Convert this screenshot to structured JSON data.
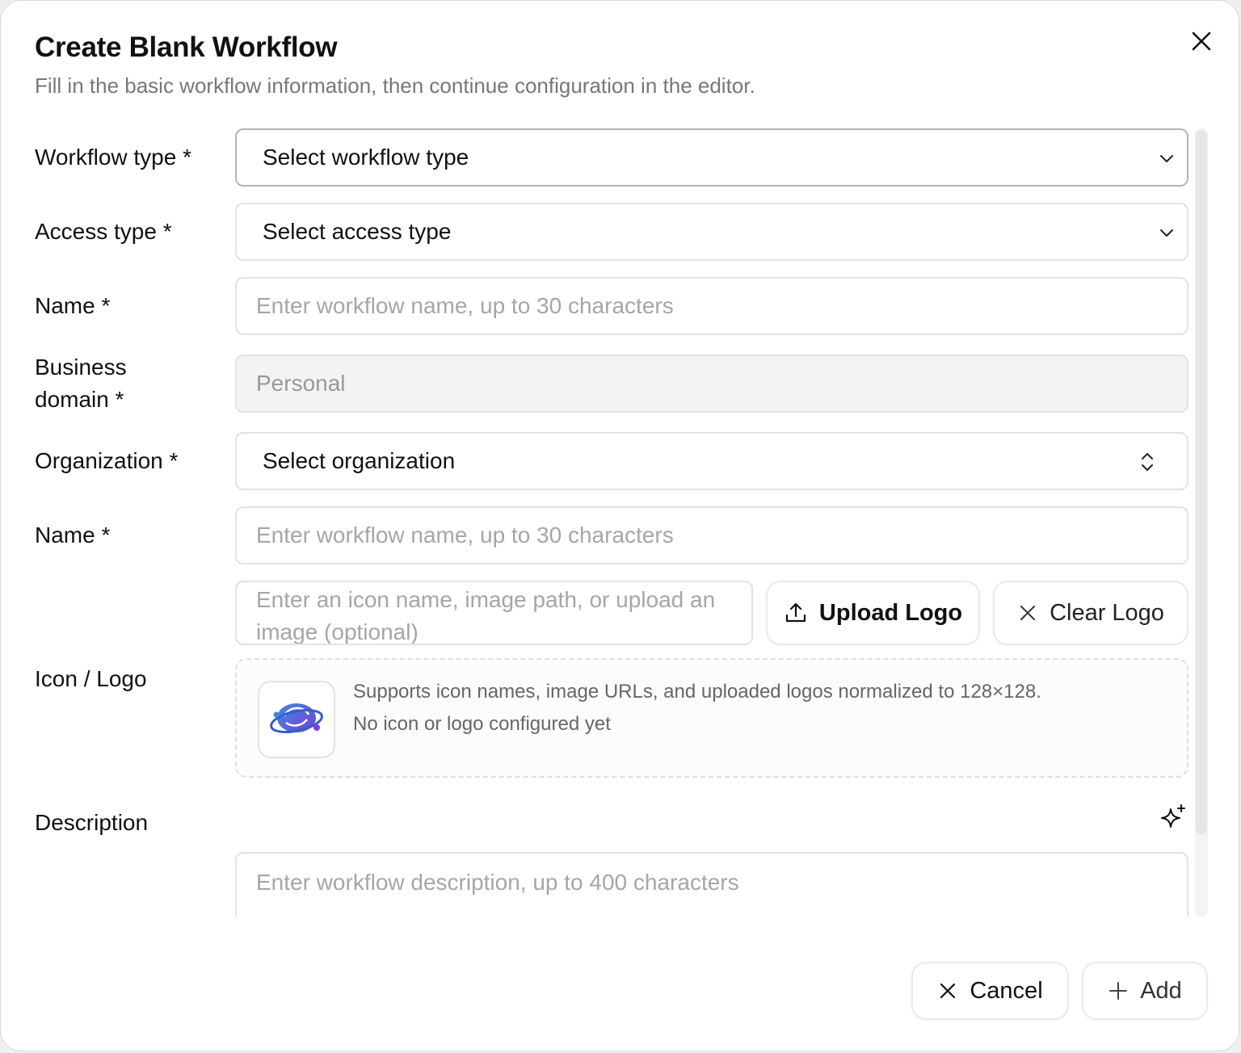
{
  "dialog": {
    "title": "Create Blank Workflow",
    "subtitle": "Fill in the basic workflow information, then continue configuration in the editor."
  },
  "form": {
    "workflow_type": {
      "label": "Workflow type *",
      "value": "Select workflow type"
    },
    "access_type": {
      "label": "Access type *",
      "value": "Select access type"
    },
    "name_1": {
      "label": "Name *",
      "placeholder": "Enter workflow name, up to 30 characters"
    },
    "business_domain": {
      "label_line1": "Business",
      "label_line2": "domain *",
      "value": "Personal"
    },
    "organization": {
      "label": "Organization *",
      "value": "Select organization"
    },
    "name_2": {
      "label": "Name *",
      "placeholder": "Enter workflow name, up to 30 characters"
    },
    "icon_logo": {
      "label": "Icon / Logo",
      "input_placeholder": "Enter an icon name, image path, or upload an image (optional)",
      "upload_label": "Upload Logo",
      "clear_label": "Clear Logo",
      "hint": "Supports icon names, image URLs, and uploaded logos normalized to 128×128.",
      "status": "No icon or logo configured yet"
    },
    "description": {
      "label": "Description",
      "placeholder": "Enter workflow description, up to 400 characters"
    }
  },
  "footer": {
    "cancel_label": "Cancel",
    "add_label": "Add"
  },
  "colors": {
    "border": "#e3e3e3",
    "placeholder": "#a6a6a6",
    "logo_blue": "#3a6fd8",
    "logo_purple": "#7b3fd1"
  }
}
